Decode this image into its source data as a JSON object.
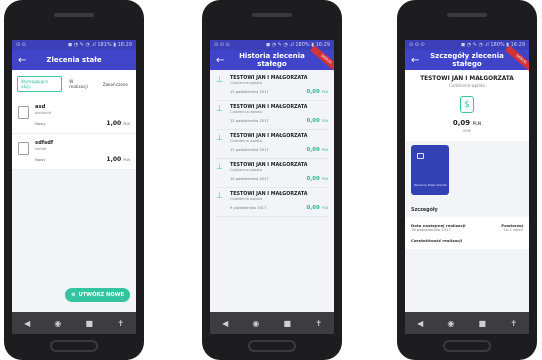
{
  "phone1": {
    "status": {
      "left": "⊙ ⊙",
      "right": "◼ ◔ ✎ ◔ .ıl 181% ▮ 16:29"
    },
    "title": "Zlecenia stałe",
    "filters": [
      "Wymagające akcji",
      "W realizacji",
      "Zakończone"
    ],
    "orders": [
      {
        "name": "asd",
        "sub": "asdfasdf",
        "status": "Nowy",
        "amount": "1,00",
        "currency": "PLN"
      },
      {
        "name": "sdfsdf",
        "sub": "sdfsdf",
        "status": "Nowy",
        "amount": "1,00",
        "currency": "PLN"
      }
    ],
    "fab_label": "UTWÓRZ NOWE"
  },
  "phone2": {
    "status": {
      "left": "⊙ ⊙ ⊙",
      "right": "◼ ◔ ✎ ◔ .ıl 180% ▮ 16:29"
    },
    "title": "Historia zlecenia stałego",
    "ribbon": "DEBUG",
    "items": [
      {
        "name": "TESTOWI JAN I MAŁGORZATA",
        "type": "Codzienna wpłata",
        "date": "13 października 2017",
        "amount": "0,09",
        "currency": "PLN"
      },
      {
        "name": "TESTOWI JAN I MAŁGORZATA",
        "type": "Codzienna wpłata",
        "date": "12 października 2017",
        "amount": "0,09",
        "currency": "PLN"
      },
      {
        "name": "TESTOWI JAN I MAŁGORZATA",
        "type": "Codzienna wpłata",
        "date": "11 października 2017",
        "amount": "0,09",
        "currency": "PLN"
      },
      {
        "name": "TESTOWI JAN I MAŁGORZATA",
        "type": "Codzienna wpłata",
        "date": "10 października 2017",
        "amount": "0,09",
        "currency": "PLN"
      },
      {
        "name": "TESTOWI JAN I MAŁGORZATA",
        "type": "Codzienna wpłata",
        "date": "9 października 2017",
        "amount": "0,09",
        "currency": "PLN"
      }
    ]
  },
  "phone3": {
    "status": {
      "left": "⊙ ⊙ ⊙",
      "right": "◼ ◔ ✎ ◔ .ıl 180% ▮ 16:29"
    },
    "title": "Szczegóły zlecenia stałego",
    "ribbon": "DEBUG",
    "name": "TESTOWI JAN I MAŁGORZATA",
    "type": "Codzienna wpłata",
    "amount": "0,09",
    "currency": "PLN",
    "method": "SMS",
    "card_label": "Zlecenie Stałe Klienta",
    "section_title": "Szczegóły",
    "next_label": "Data następnej realizacji",
    "next_value": "16 października 2017",
    "repeat_label": "Powtarzaj",
    "repeat_value": "Co 1 dzień",
    "freq_label": "Częstotliwość realizacji"
  },
  "nav": {
    "back": "◀",
    "home": "◉",
    "recent": "■",
    "extra": "✝"
  }
}
